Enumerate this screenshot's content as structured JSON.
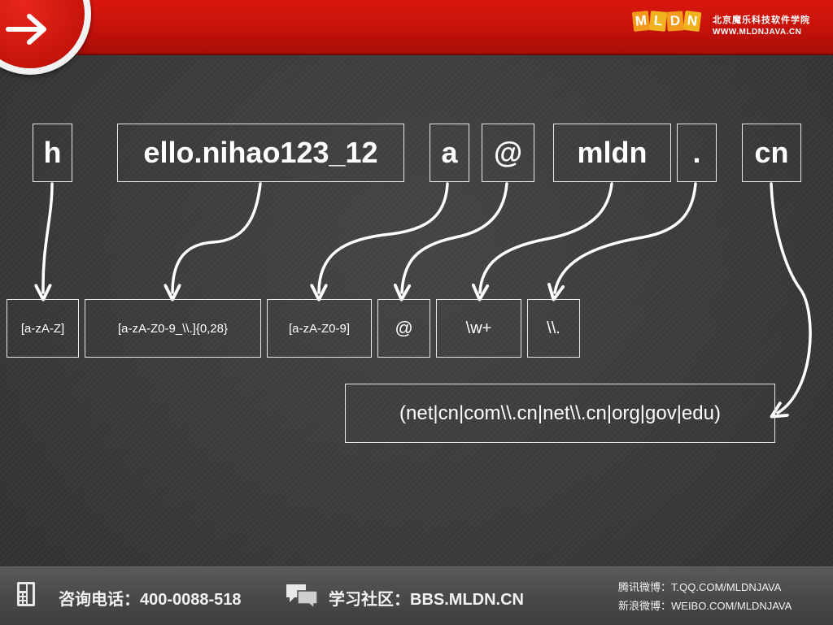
{
  "header": {
    "logo_letters": [
      "M",
      "L",
      "D",
      "N"
    ],
    "brand_name": "北京魔乐科技软件学院",
    "brand_url": "WWW.MLDNJAVA.CN",
    "accent_color": "#c4120a"
  },
  "email_parts": [
    "h",
    "ello.nihao123_12",
    "a",
    "@",
    "mldn",
    ".",
    "cn"
  ],
  "patterns": [
    "[a-zA-Z]",
    "[a-zA-Z0-9_\\\\.]{0,28}",
    "[a-zA-Z0-9]",
    "@",
    "\\w+",
    "\\\\."
  ],
  "suffix_pattern": "(net|cn|com\\\\.cn|net\\\\.cn|org|gov|edu)",
  "footer": {
    "phone_label": "咨询电话：400-0088-518",
    "bbs_label": "学习社区：BBS.MLDN.CN",
    "tencent_weibo": "腾讯微博：T.QQ.COM/MLDNJAVA",
    "sina_weibo": "新浪微博：WEIBO.COM/MLDNJAVA"
  }
}
